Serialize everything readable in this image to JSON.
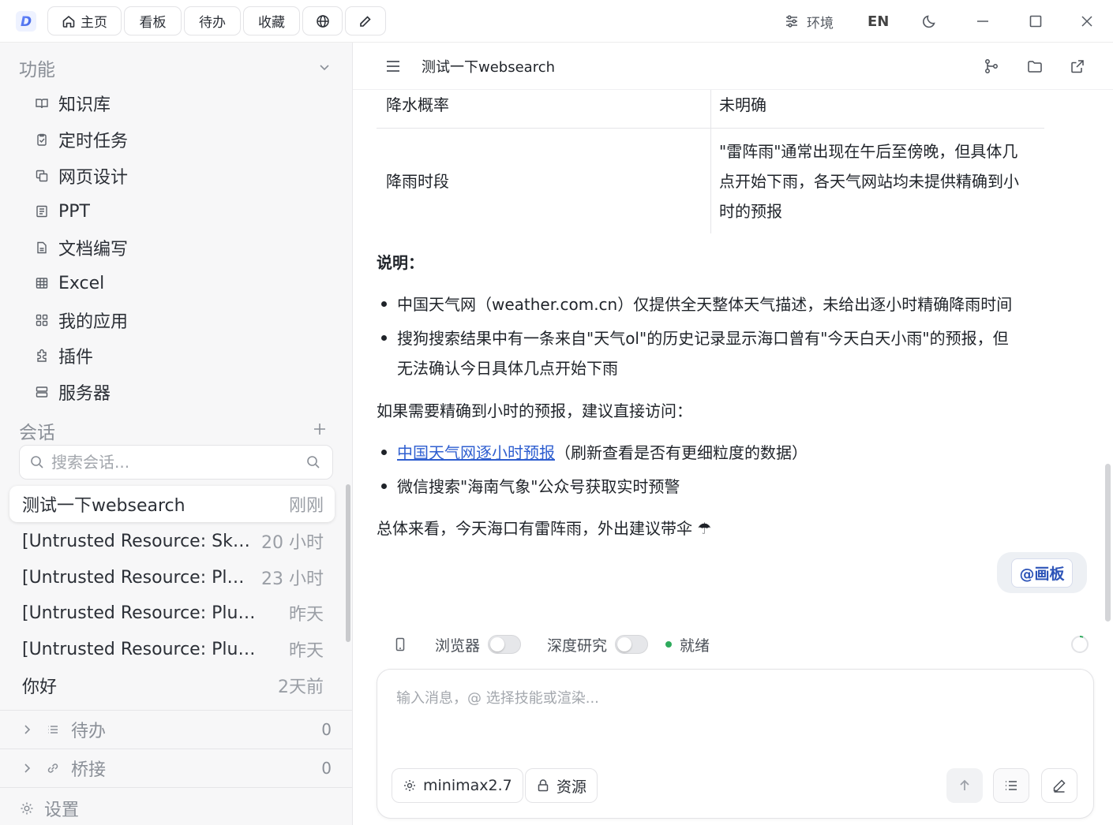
{
  "titlebar": {
    "tabs": [
      {
        "label": "主页",
        "icon": "home-icon"
      },
      {
        "label": "看板"
      },
      {
        "label": "待办"
      },
      {
        "label": "收藏"
      },
      {
        "label": "",
        "icon": "globe-icon"
      },
      {
        "label": "",
        "icon": "pencil-icon"
      }
    ],
    "env_label": "环境",
    "lang_label": "EN"
  },
  "sidebar": {
    "features_title": "功能",
    "features": [
      {
        "label": "知识库",
        "icon": "book-icon"
      },
      {
        "label": "定时任务",
        "icon": "clipboard-check-icon"
      },
      {
        "label": "网页设计",
        "icon": "layers-icon"
      },
      {
        "label": "PPT",
        "icon": "presentation-icon"
      },
      {
        "label": "文档编写",
        "icon": "document-icon"
      },
      {
        "label": "Excel",
        "icon": "table-icon"
      },
      {
        "label": "我的应用",
        "icon": "apps-grid-icon"
      },
      {
        "label": "插件",
        "icon": "puzzle-icon"
      },
      {
        "label": "服务器",
        "icon": "server-icon"
      }
    ],
    "conversations_title": "会话",
    "search_placeholder": "搜索会话...",
    "conversations": [
      {
        "title": "测试一下websearch",
        "time": "刚刚",
        "active": true
      },
      {
        "title": "[Untrusted Resource: Skill...",
        "time": "20 小时"
      },
      {
        "title": "[Untrusted Resource: Plu...",
        "time": "23 小时"
      },
      {
        "title": "[Untrusted Resource: Plugin ...",
        "time": "昨天"
      },
      {
        "title": "[Untrusted Resource: Plugin ...",
        "time": "昨天"
      },
      {
        "title": "你好",
        "time": "2天前"
      }
    ],
    "todo": {
      "label": "待办",
      "count": "0"
    },
    "bridge": {
      "label": "桥接",
      "count": "0"
    },
    "settings_label": "设置"
  },
  "main": {
    "conversation_title": "测试一下websearch",
    "table_rows": [
      {
        "key": "降水概率",
        "value": [
          "未明确"
        ]
      },
      {
        "key": "降雨时段",
        "value": [
          "\"雷阵雨\"通常出现在午后至傍晚，但具体几",
          "点开始下雨，各天气网站均未提供精确到小",
          "时的预报"
        ]
      }
    ],
    "notes_heading": "说明：",
    "notes": [
      [
        "中国天气网（weather.com.cn）仅提供全天整体天气描述，未给出逐小时精确降雨时间"
      ],
      [
        "搜狗搜索结果中有一条来自\"天气ol\"的历史记录显示海口曾有\"今天白天小雨\"的预报，但",
        "无法确认今日具体几点开始下雨"
      ]
    ],
    "suggest_intro": "如果需要精确到小时的预报，建议直接访问：",
    "suggest_link": "中国天气网逐小时预报",
    "suggest_link_note": "（刷新查看是否有更细粒度的数据）",
    "suggest_item2": "微信搜索\"海南气象\"公众号获取实时预警",
    "summary": "总体来看，今天海口有雷阵雨，外出建议带伞 ☂",
    "canvas_chip": "@画板",
    "toolbar": {
      "browser_label": "浏览器",
      "deep_research_label": "深度研究",
      "status_label": "就绪",
      "status_color": "#2eaa5c"
    },
    "composer": {
      "placeholder": "输入消息，@ 选择技能或渲染...",
      "model_label": "minimax2.7",
      "resource_label": "资源"
    }
  }
}
